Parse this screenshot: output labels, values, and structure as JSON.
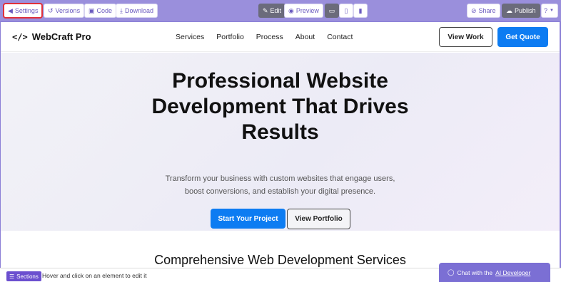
{
  "toolbar": {
    "settings_label": "Settings",
    "versions_label": "Versions",
    "code_label": "Code",
    "download_label": "Download",
    "edit_label": "Edit",
    "preview_label": "Preview",
    "share_label": "Share",
    "publish_label": "Publish",
    "help_icon": "?",
    "icons": {
      "settings": "back-arrow-icon",
      "versions": "history-icon",
      "code": "lock-icon",
      "download": "download-icon",
      "edit": "edit-icon",
      "preview": "eye-icon",
      "desktop": "desktop-icon",
      "tablet": "tablet-icon",
      "mobile": "mobile-icon",
      "share": "link-icon",
      "publish": "cloud-upload-icon"
    }
  },
  "site": {
    "logo_text": "WebCraft Pro",
    "logo_mark": "</>",
    "nav": [
      "Services",
      "Portfolio",
      "Process",
      "About",
      "Contact"
    ],
    "view_work": "View Work",
    "get_quote": "Get Quote",
    "hero_title": "Professional Website Development That Drives Results",
    "hero_subtitle": "Transform your business with custom websites that engage users, boost conversions, and establish your digital presence.",
    "start_project": "Start Your Project",
    "view_portfolio": "View Portfolio",
    "section_title": "Comprehensive Web Development Services"
  },
  "statusbar": {
    "sections_label": "Sections",
    "hint": "Hover and click on an element to edit it"
  },
  "chat": {
    "prefix": "Chat with the",
    "link": "AI Developer"
  },
  "colors": {
    "toolbar": "#9a8fdc",
    "accent": "#6b5bbf",
    "primary_button": "#0d7cf2",
    "selected_outline": "#e0303a"
  }
}
